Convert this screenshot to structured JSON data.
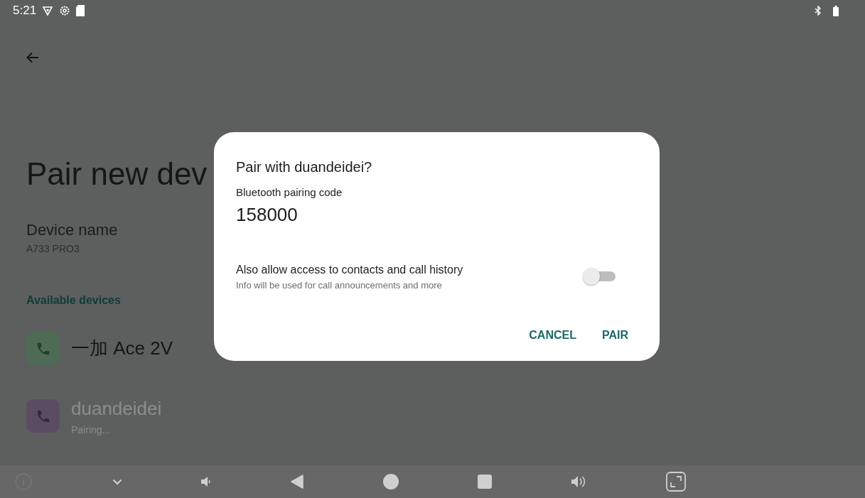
{
  "status_bar": {
    "time": "5:21"
  },
  "page": {
    "title": "Pair new dev",
    "device_name_label": "Device name",
    "device_name": "A733 PRO3",
    "section": "Available devices",
    "devices": [
      {
        "name": "一加 Ace 2V",
        "color": "#4e6b55",
        "disabled": false
      },
      {
        "name": "duandeidei",
        "status": "Pairing...",
        "color": "#5a4d63",
        "disabled": true
      }
    ]
  },
  "dialog": {
    "title": "Pair with duandeidei?",
    "code_label": "Bluetooth pairing code",
    "code": "158000",
    "option": {
      "label": "Also allow access to contacts and call history",
      "hint": "Info will be used for call announcements and more",
      "on": false
    },
    "buttons": [
      "CANCEL",
      "PAIR"
    ]
  }
}
